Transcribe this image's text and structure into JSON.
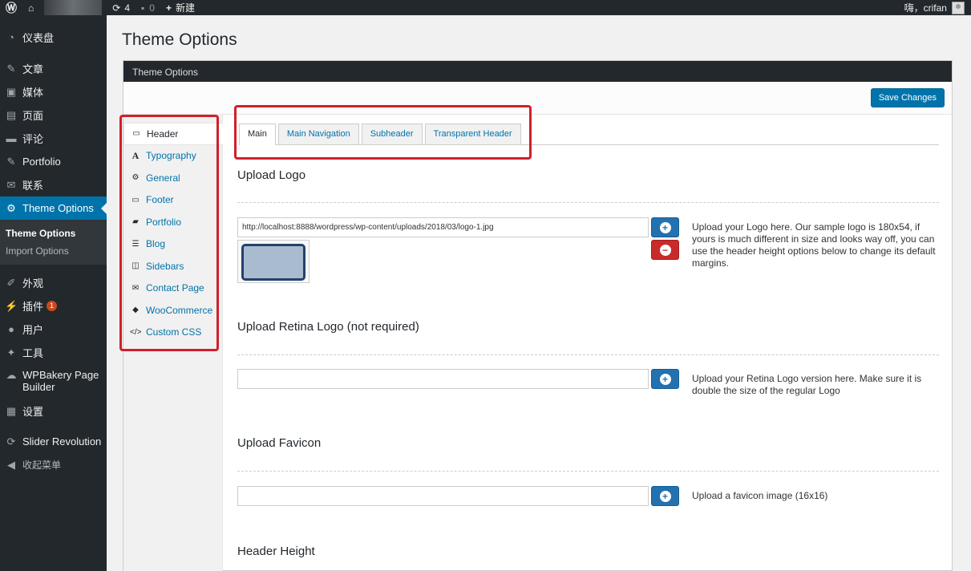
{
  "adminbar": {
    "updates_count": "4",
    "comments_count": "0",
    "new_label": "新建",
    "greeting": "嗨，crifan"
  },
  "sidebar": {
    "items": [
      {
        "label": "仪表盘",
        "icon": "dashboard-icon"
      },
      {
        "label": "文章",
        "icon": "pin-icon"
      },
      {
        "label": "媒体",
        "icon": "media-icon"
      },
      {
        "label": "页面",
        "icon": "page-icon"
      },
      {
        "label": "评论",
        "icon": "comment-icon"
      },
      {
        "label": "Portfolio",
        "icon": "pin-icon"
      },
      {
        "label": "联系",
        "icon": "mail-icon"
      },
      {
        "label": "Theme Options",
        "icon": "gear-icon"
      }
    ],
    "submenu": [
      "Theme Options",
      "Import Options"
    ],
    "items2": [
      {
        "label": "外观",
        "icon": "brush-icon"
      },
      {
        "label": "插件",
        "icon": "plugin-icon",
        "badge": "1"
      },
      {
        "label": "用户",
        "icon": "user-icon"
      },
      {
        "label": "工具",
        "icon": "wrench-icon"
      },
      {
        "label": "WPBakery Page Builder",
        "icon": "cloud-icon"
      },
      {
        "label": "设置",
        "icon": "settings-icon"
      },
      {
        "label": "Slider Revolution",
        "icon": "refresh-icon"
      },
      {
        "label": "收起菜单",
        "icon": "collapse-icon"
      }
    ]
  },
  "page": {
    "title": "Theme Options",
    "panel_title": "Theme Options",
    "save_label": "Save Changes"
  },
  "options_nav": [
    {
      "label": "Header",
      "icon": "monitor-icon"
    },
    {
      "label": "Typography",
      "icon": "typography-icon"
    },
    {
      "label": "General",
      "icon": "gear-icon"
    },
    {
      "label": "Footer",
      "icon": "monitor-icon"
    },
    {
      "label": "Portfolio",
      "icon": "briefcase-icon"
    },
    {
      "label": "Blog",
      "icon": "list-icon"
    },
    {
      "label": "Sidebars",
      "icon": "columns-icon"
    },
    {
      "label": "Contact Page",
      "icon": "envelope-icon"
    },
    {
      "label": "WooCommerce",
      "icon": "tag-icon"
    },
    {
      "label": "Custom CSS",
      "icon": "code-icon"
    }
  ],
  "tabs": [
    "Main",
    "Main Navigation",
    "Subheader",
    "Transparent Header"
  ],
  "sections": {
    "logo": {
      "title": "Upload Logo",
      "value": "http://localhost:8888/wordpress/wp-content/uploads/2018/03/logo-1.jpg",
      "desc": "Upload your Logo here. Our sample logo is 180x54, if yours is much different in size and looks way off, you can use the header height options below to change its default margins."
    },
    "retina": {
      "title": "Upload Retina Logo (not required)",
      "value": "",
      "desc": "Upload your Retina Logo version here. Make sure it is double the size of the regular Logo"
    },
    "favicon": {
      "title": "Upload Favicon",
      "value": "",
      "desc": "Upload a favicon image (16x16)"
    },
    "header_height": {
      "title": "Header Height"
    }
  },
  "colors": {
    "admin_dark": "#23282d",
    "accent_blue": "#0073aa",
    "highlight_red": "#d0202a",
    "remove_red": "#c92a2a"
  }
}
